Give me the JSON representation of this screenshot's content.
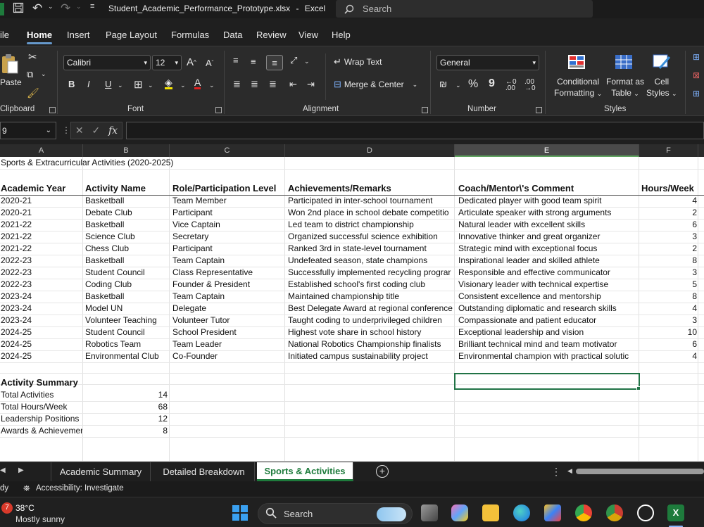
{
  "titlebar": {
    "filename": "Student_Academic_Performance_Prototype.xlsx",
    "separator": "-",
    "app": "Excel",
    "search_placeholder": "Search"
  },
  "menu": {
    "tabs": [
      "ile",
      "Home",
      "Insert",
      "Page Layout",
      "Formulas",
      "Data",
      "Review",
      "View",
      "Help"
    ],
    "active": "Home"
  },
  "ribbon": {
    "clipboard": {
      "paste": "Paste",
      "label": "Clipboard"
    },
    "font": {
      "name": "Calibri",
      "size": "12",
      "grow": "A",
      "shrink": "A",
      "bold": "B",
      "italic": "I",
      "underline": "U",
      "label": "Font"
    },
    "alignment": {
      "wrap_text": "Wrap Text",
      "merge_center": "Merge & Center",
      "label": "Alignment"
    },
    "number": {
      "format": "General",
      "percent": "%",
      "comma": "9",
      "label": "Number"
    },
    "styles": {
      "conditional": "Conditional",
      "formatting": "Formatting",
      "format_as": "Format as",
      "table": "Table",
      "cell": "Cell",
      "styles_btn": "Styles",
      "label": "Styles"
    }
  },
  "formula_bar": {
    "name_box": "9",
    "fx": "fx",
    "value": ""
  },
  "columns": [
    "A",
    "B",
    "C",
    "D",
    "E",
    "F"
  ],
  "selected_column": "E",
  "sheet": {
    "title": "Sports & Extracurricular Activities (2020-2025)",
    "headers": [
      "Academic Year",
      "Activity Name",
      "Role/Participation Level",
      "Achievements/Remarks",
      "Coach/Mentor\\'s Comment",
      "Hours/Week"
    ],
    "rows": [
      [
        "2020-21",
        "Basketball",
        "Team Member",
        "Participated in inter-school tournament",
        "Dedicated player with good team spirit",
        "4"
      ],
      [
        "2020-21",
        "Debate Club",
        "Participant",
        "Won 2nd place in school debate competitio",
        "Articulate speaker with strong arguments",
        "2"
      ],
      [
        "2021-22",
        "Basketball",
        "Vice Captain",
        "Led team to district championship",
        "Natural leader with excellent skills",
        "6"
      ],
      [
        "2021-22",
        "Science Club",
        "Secretary",
        "Organized successful science exhibition",
        "Innovative thinker and great organizer",
        "3"
      ],
      [
        "2021-22",
        "Chess Club",
        "Participant",
        "Ranked 3rd in state-level tournament",
        "Strategic mind with exceptional focus",
        "2"
      ],
      [
        "2022-23",
        "Basketball",
        "Team Captain",
        "Undefeated season, state champions",
        "Inspirational leader and skilled athlete",
        "8"
      ],
      [
        "2022-23",
        "Student Council",
        "Class Representative",
        "Successfully implemented recycling prograr",
        "Responsible and effective communicator",
        "3"
      ],
      [
        "2022-23",
        "Coding Club",
        "Founder & President",
        "Established school's first coding club",
        "Visionary leader with technical expertise",
        "5"
      ],
      [
        "2023-24",
        "Basketball",
        "Team Captain",
        "Maintained championship title",
        "Consistent excellence and mentorship",
        "8"
      ],
      [
        "2023-24",
        "Model UN",
        "Delegate",
        "Best Delegate Award at regional conference",
        "Outstanding diplomatic and research skills",
        "4"
      ],
      [
        "2023-24",
        "Volunteer Teaching",
        "Volunteer Tutor",
        "Taught coding to underprivileged children",
        "Compassionate and patient educator",
        "3"
      ],
      [
        "2024-25",
        "Student Council",
        "School President",
        "Highest vote share in school history",
        "Exceptional leadership and vision",
        "10"
      ],
      [
        "2024-25",
        "Robotics Team",
        "Team Leader",
        "National Robotics Championship finalists",
        "Brilliant technical mind and team motivator",
        "6"
      ],
      [
        "2024-25",
        "Environmental Club",
        "Co-Founder",
        "Initiated campus sustainability project",
        "Environmental champion with practical solutic",
        "4"
      ]
    ],
    "summary_title": "Activity Summary",
    "summary": [
      [
        "Total Activities",
        "14"
      ],
      [
        "Total Hours/Week",
        "68"
      ],
      [
        "Leadership Positions",
        "12"
      ],
      [
        "Awards & Achievemer",
        "8"
      ]
    ]
  },
  "sheet_tabs": [
    "Academic Summary",
    "Detailed Breakdown",
    "Sports & Activities"
  ],
  "active_sheet": "Sports & Activities",
  "status": {
    "ready": "dy",
    "accessibility": "Accessibility: Investigate"
  },
  "taskbar": {
    "weather_badge": "7",
    "temperature": "38°C",
    "condition": "Mostly sunny",
    "search": "Search"
  },
  "colors": {
    "excel_green": "#217346",
    "active_tab_text": "#1e7b3c"
  }
}
